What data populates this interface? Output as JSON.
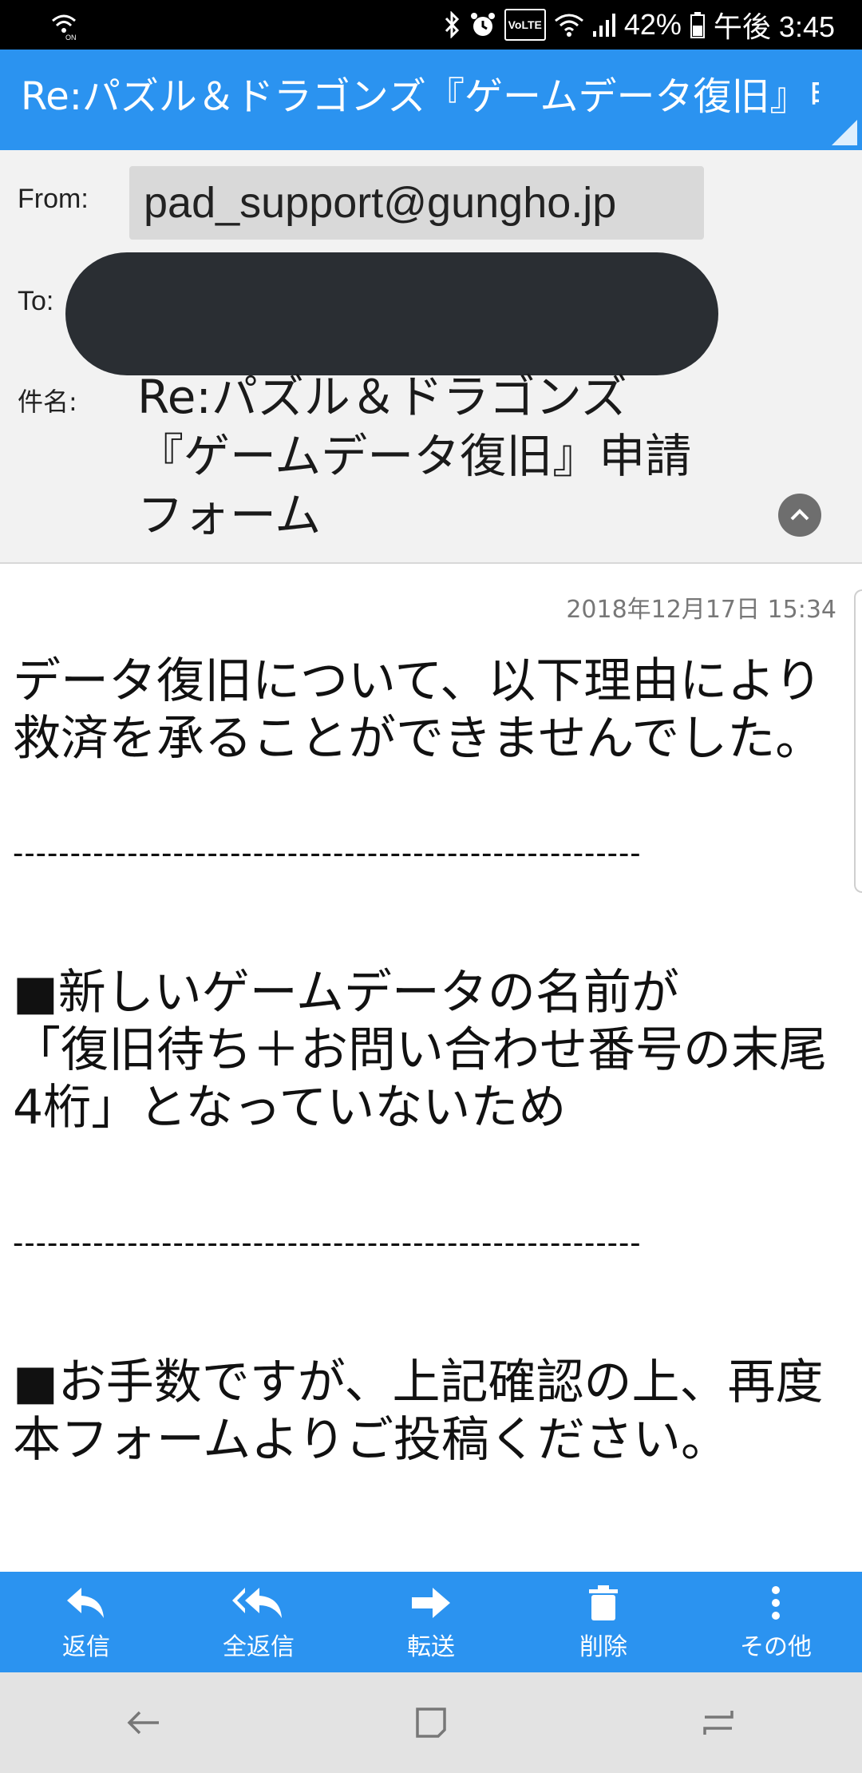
{
  "status_bar": {
    "battery": "42%",
    "time": "午後 3:45",
    "volte": "VoLTE",
    "icons": [
      "wifi-calling-icon",
      "bluetooth-icon",
      "alarm-icon",
      "volte-icon",
      "wifi-icon",
      "signal-icon",
      "battery-icon"
    ]
  },
  "title_bar": {
    "title": "Re:パズル＆ドラゴンズ『ゲームデータ復旧』申…"
  },
  "header": {
    "from_label": "From:",
    "from_value": "pad_support@gungho.jp",
    "to_label": "To:",
    "subject_label": "件名:",
    "subject_lines": [
      "Re:パズル＆ドラゴンズ",
      "『ゲームデータ復旧』申請",
      "フォーム"
    ]
  },
  "body": {
    "date": "2018年12月17日 15:34",
    "lines": [
      "データ復旧について、以下理由により",
      "救済を承ることができませんでした。",
      "■新しいゲームデータの名前が",
      "「復旧待ち＋お問い合わせ番号の末尾",
      "4桁」となっていないため",
      "■お手数ですが、上記確認の上、再度",
      "本フォームよりご投稿ください。"
    ],
    "separator": "-------------------------------------------------------"
  },
  "toolbar": {
    "reply": "返信",
    "reply_all": "全返信",
    "forward": "転送",
    "delete": "削除",
    "more": "その他"
  },
  "colors": {
    "accent": "#2b93f0",
    "header_bg": "#f2f2f2",
    "redaction": "#2a2e33"
  }
}
